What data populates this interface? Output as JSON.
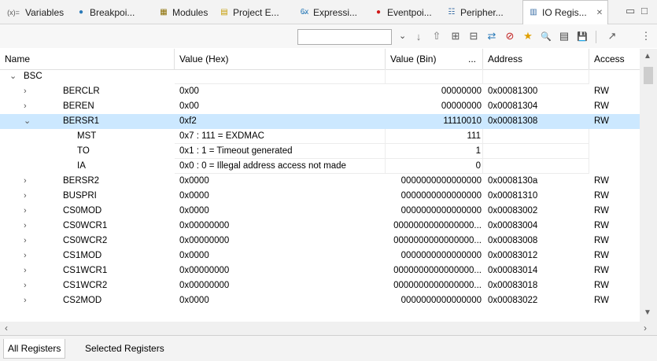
{
  "tabs": [
    {
      "icon": "(x)=",
      "label": "Variables"
    },
    {
      "icon": "●",
      "label": "Breakpoi..."
    },
    {
      "icon": "▦",
      "label": "Modules"
    },
    {
      "icon": "▤",
      "label": "Project E..."
    },
    {
      "icon": "6̶x",
      "label": "Expressi..."
    },
    {
      "icon": "●",
      "label": "Eventpoi..."
    },
    {
      "icon": "☷",
      "label": "Peripher..."
    },
    {
      "icon": "▥",
      "label": "IO Regis..."
    }
  ],
  "tab_close": "✕",
  "toolbar": {
    "combo_value": "",
    "buttons": [
      "↓",
      "⇧",
      "⊞",
      "⊟",
      "⇄",
      "⊘",
      "★",
      "🔍",
      "▤",
      "💾",
      "↗",
      "⋮"
    ]
  },
  "columns": {
    "name": "Name",
    "hex": "Value (Hex)",
    "bin": "Value (Bin)",
    "bin_more": "...",
    "address": "Address",
    "access": "Access"
  },
  "rows": [
    {
      "chev": "⌄",
      "name": "BSC",
      "hex": "",
      "bin": "",
      "addr": "",
      "acc": "",
      "level": 0
    },
    {
      "chev": "›",
      "name": "BERCLR",
      "hex": "0x00",
      "bin": "00000000",
      "addr": "0x00081300",
      "acc": "RW",
      "level": 1
    },
    {
      "chev": "›",
      "name": "BEREN",
      "hex": "0x00",
      "bin": "00000000",
      "addr": "0x00081304",
      "acc": "RW",
      "level": 1
    },
    {
      "chev": "⌄",
      "name": "BERSR1",
      "hex": "0xf2",
      "bin": "11110010",
      "addr": "0x00081308",
      "acc": "RW",
      "level": 1,
      "selected": true
    },
    {
      "chev": "",
      "name": "MST",
      "hex": "0x7 : 111 =  EXDMAC",
      "bin": "111",
      "addr": "",
      "acc": "",
      "level": 2
    },
    {
      "chev": "",
      "name": "TO",
      "hex": "0x1 : 1 =  Timeout generated",
      "bin": "1",
      "addr": "",
      "acc": "",
      "level": 2
    },
    {
      "chev": "",
      "name": "IA",
      "hex": "0x0 : 0 =  Illegal address access not made",
      "bin": "0",
      "addr": "",
      "acc": "",
      "level": 2
    },
    {
      "chev": "›",
      "name": "BERSR2",
      "hex": "0x0000",
      "bin": "0000000000000000",
      "addr": "0x0008130a",
      "acc": "RW",
      "level": 1
    },
    {
      "chev": "›",
      "name": "BUSPRI",
      "hex": "0x0000",
      "bin": "0000000000000000",
      "addr": "0x00081310",
      "acc": "RW",
      "level": 1
    },
    {
      "chev": "›",
      "name": "CS0MOD",
      "hex": "0x0000",
      "bin": "0000000000000000",
      "addr": "0x00083002",
      "acc": "RW",
      "level": 1
    },
    {
      "chev": "›",
      "name": "CS0WCR1",
      "hex": "0x00000000",
      "bin": "0000000000000000...",
      "addr": "0x00083004",
      "acc": "RW",
      "level": 1
    },
    {
      "chev": "›",
      "name": "CS0WCR2",
      "hex": "0x00000000",
      "bin": "0000000000000000...",
      "addr": "0x00083008",
      "acc": "RW",
      "level": 1
    },
    {
      "chev": "›",
      "name": "CS1MOD",
      "hex": "0x0000",
      "bin": "0000000000000000",
      "addr": "0x00083012",
      "acc": "RW",
      "level": 1
    },
    {
      "chev": "›",
      "name": "CS1WCR1",
      "hex": "0x00000000",
      "bin": "0000000000000000...",
      "addr": "0x00083014",
      "acc": "RW",
      "level": 1
    },
    {
      "chev": "›",
      "name": "CS1WCR2",
      "hex": "0x00000000",
      "bin": "0000000000000000...",
      "addr": "0x00083018",
      "acc": "RW",
      "level": 1
    },
    {
      "chev": "›",
      "name": "CS2MOD",
      "hex": "0x0000",
      "bin": "0000000000000000",
      "addr": "0x00083022",
      "acc": "RW",
      "level": 1
    }
  ],
  "bottom_tabs": [
    "All Registers",
    "Selected Registers"
  ],
  "colors": {
    "selection": "#cce8ff",
    "accent": "#0078d7"
  }
}
